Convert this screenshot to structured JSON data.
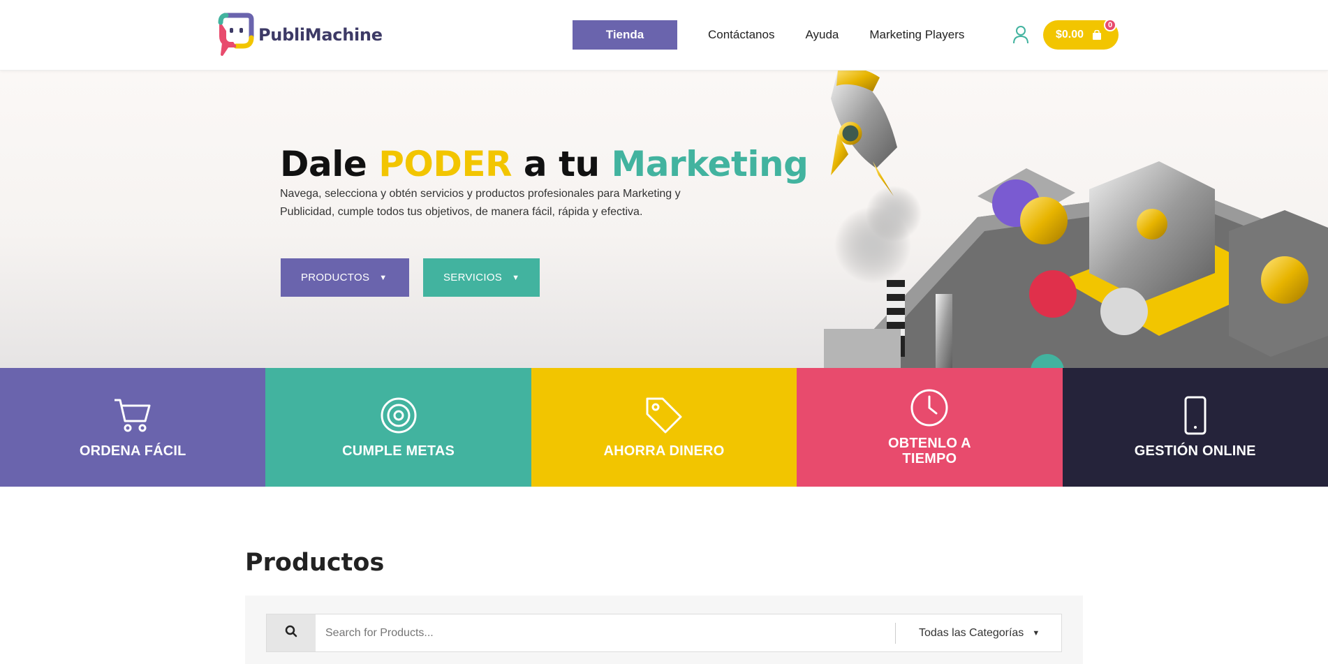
{
  "header": {
    "brand": "PubliMachine",
    "nav": [
      {
        "label": "Tienda",
        "active": true
      },
      {
        "label": "Contáctanos"
      },
      {
        "label": "Ayuda"
      },
      {
        "label": "Marketing Players"
      }
    ],
    "cart_total": "$0.00",
    "cart_count": "0",
    "icons": {
      "user": "user-icon",
      "cart": "shopping-bag-icon"
    }
  },
  "hero": {
    "title_part1": "Dale ",
    "title_highlight1": "PODER",
    "title_part2": " a tu ",
    "title_highlight2": "Marketing",
    "description": "Navega, selecciona y obtén servicios y productos profesionales para Marketing y Publicidad, cumple todos tus objetivos, de manera fácil, rápida y efectiva.",
    "buttons": [
      {
        "label": "PRODUCTOS"
      },
      {
        "label": "SERVICIOS"
      }
    ]
  },
  "features": [
    {
      "label": "ORDENA FÁCIL",
      "icon": "cart-icon",
      "color": "#6a64ad"
    },
    {
      "label": "CUMPLE METAS",
      "icon": "target-icon",
      "color": "#42b39f"
    },
    {
      "label": "AHORRA DINERO",
      "icon": "tag-icon",
      "color": "#f2c500"
    },
    {
      "label": "OBTENLO A TIEMPO",
      "icon": "clock-icon",
      "color": "#e84b6d"
    },
    {
      "label": "GESTIÓN ONLINE",
      "icon": "phone-icon",
      "color": "#25233a"
    }
  ],
  "products": {
    "title": "Productos",
    "search_placeholder": "Search for Products...",
    "category_select": "Todas las Categorías"
  },
  "colors": {
    "purple": "#6a64ad",
    "teal": "#42b39f",
    "yellow": "#f2c500",
    "pink": "#e84b6d",
    "dark": "#25233a"
  }
}
